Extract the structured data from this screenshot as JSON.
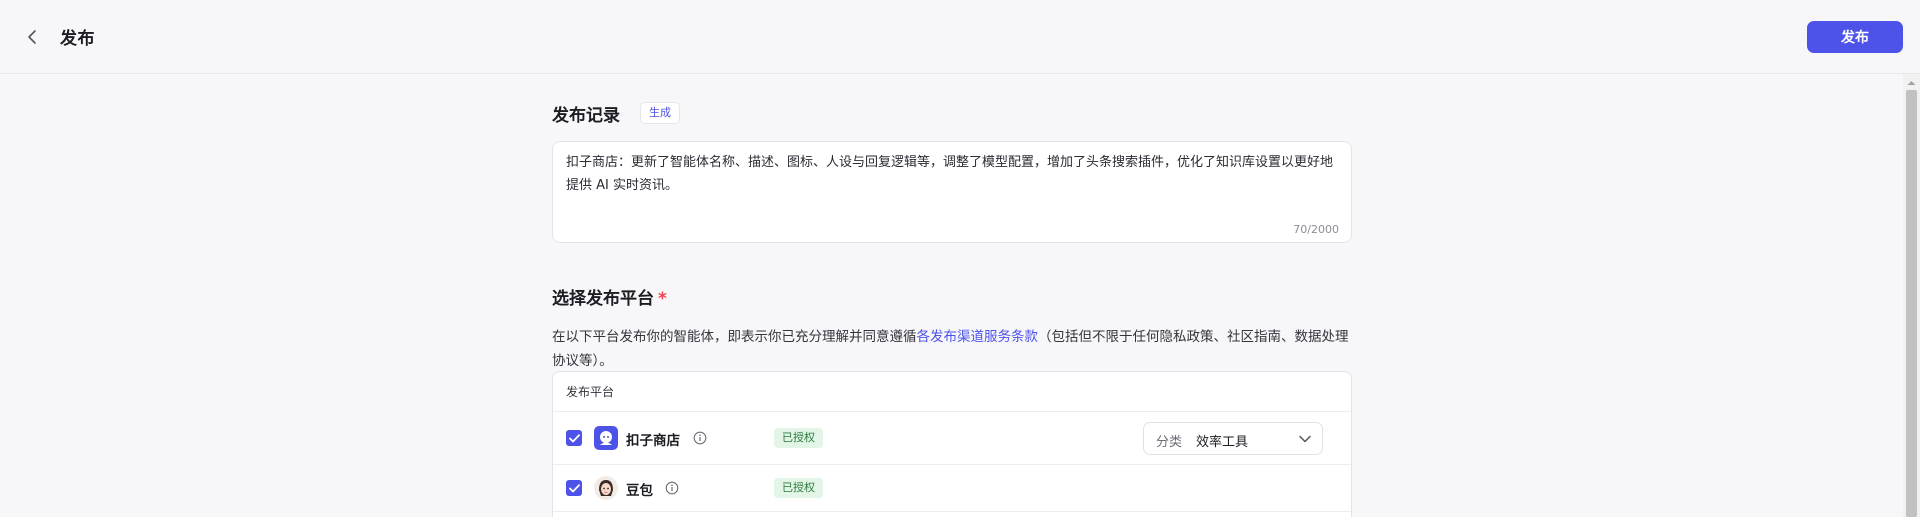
{
  "header": {
    "title": "发布",
    "publish_label": "发布"
  },
  "release_record": {
    "title": "发布记录",
    "generate_label": "生成",
    "text": "扣子商店：更新了智能体名称、描述、图标、人设与回复逻辑等，调整了模型配置，增加了头条搜索插件，优化了知识库设置以更好地提供 AI 实时资讯。",
    "counter": "70/2000"
  },
  "platforms": {
    "title": "选择发布平台",
    "required_mark": "*",
    "desc_before": "在以下平台发布你的智能体，即表示你已充分理解并同意遵循",
    "desc_link": "各发布渠道服务条款",
    "desc_after": "（包括但不限于任何隐私政策、社区指南、数据处理协议等）。",
    "table_header": "发布平台",
    "rows": [
      {
        "name": "扣子商店",
        "checked": true,
        "status": "已授权",
        "logo": "coze-store-logo",
        "category_label": "分类",
        "category_value": "效率工具"
      },
      {
        "name": "豆包",
        "checked": true,
        "status": "已授权",
        "logo": "doubao-logo"
      }
    ]
  },
  "colors": {
    "accent": "#4d53e8",
    "authorized_bg": "#e2f5e6",
    "authorized_text": "#2b7a3c",
    "required": "#f0424c"
  }
}
